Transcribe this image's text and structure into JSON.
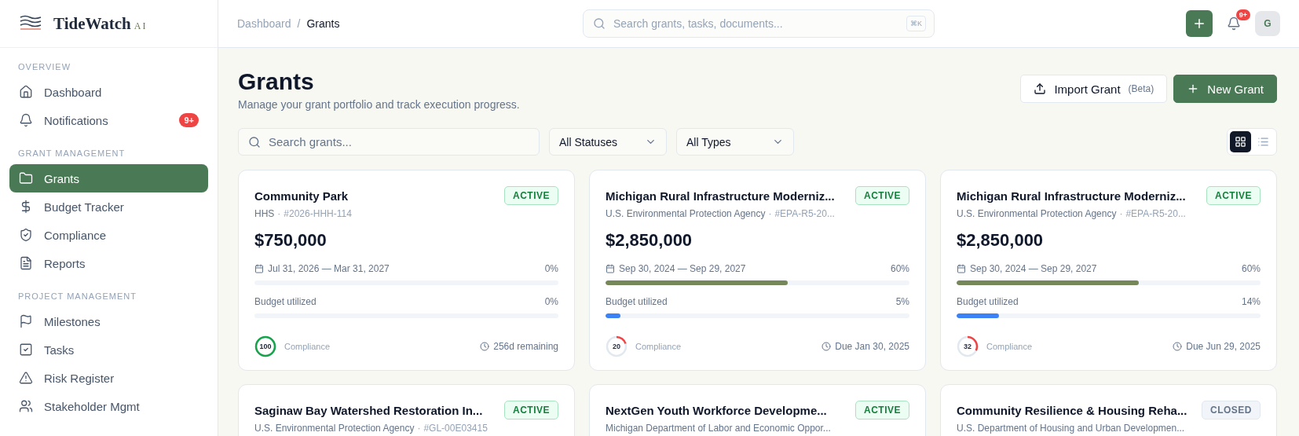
{
  "brand": {
    "name": "TideWatch",
    "suffix": "AI"
  },
  "sidebar": {
    "sections": [
      {
        "title": "OVERVIEW",
        "items": [
          {
            "label": "Dashboard",
            "selected": false
          },
          {
            "label": "Notifications",
            "selected": false,
            "badge": "9+"
          }
        ]
      },
      {
        "title": "GRANT MANAGEMENT",
        "items": [
          {
            "label": "Grants",
            "selected": true
          },
          {
            "label": "Budget Tracker",
            "selected": false
          },
          {
            "label": "Compliance",
            "selected": false
          },
          {
            "label": "Reports",
            "selected": false
          }
        ]
      },
      {
        "title": "PROJECT MANAGEMENT",
        "items": [
          {
            "label": "Milestones",
            "selected": false
          },
          {
            "label": "Tasks",
            "selected": false
          },
          {
            "label": "Risk Register",
            "selected": false
          },
          {
            "label": "Stakeholder Mgmt",
            "selected": false
          }
        ]
      }
    ]
  },
  "header": {
    "breadcrumbs": [
      "Dashboard",
      "Grants"
    ],
    "breadcrumb_separator": "/",
    "search": {
      "placeholder": "Search grants, tasks, documents...",
      "shortcut": "⌘K"
    },
    "notification_badge": "9+",
    "avatar": "G"
  },
  "page": {
    "title": "Grants",
    "subtitle": "Manage your grant portfolio and track execution progress.",
    "import_button": {
      "label": "Import Grant",
      "note": "(Beta)"
    },
    "new_button": "New Grant"
  },
  "filters": {
    "search_placeholder": "Search grants...",
    "status": "All Statuses",
    "type": "All Types",
    "views": [
      {
        "kind": "grid",
        "selected": true
      },
      {
        "kind": "list",
        "selected": false
      }
    ]
  },
  "grants": [
    {
      "title": "Community Park",
      "status": "ACTIVE",
      "agency": "HHS",
      "separator": "·",
      "number": "#2026-HHH-114",
      "amount": "$750,000",
      "dates": "Jul 31, 2026 — Mar 31, 2027",
      "timeline_percent": "0%",
      "timeline": {
        "level": 0
      },
      "budget_label": "Budget utilized",
      "budget_percent": "0%",
      "budget": {
        "level": 0
      },
      "compliance": {
        "score": "100",
        "level": 1
      },
      "compliance_label": "Compliance",
      "footer": "256d remaining"
    },
    {
      "title": "Michigan Rural Infrastructure Moderniz...",
      "status": "ACTIVE",
      "agency": "U.S. Environmental Protection Agency",
      "separator": "·",
      "number": "#EPA-R5-20...",
      "amount": "$2,850,000",
      "dates": "Sep 30, 2024 — Sep 29, 2027",
      "timeline_percent": "60%",
      "timeline": {
        "level": 0.6
      },
      "budget_label": "Budget utilized",
      "budget_percent": "5%",
      "budget": {
        "level": 0.05
      },
      "compliance": {
        "score": "20",
        "level": 0.2
      },
      "compliance_label": "Compliance",
      "footer": "Due Jan 30, 2025"
    },
    {
      "title": "Michigan Rural Infrastructure Moderniz...",
      "status": "ACTIVE",
      "agency": "U.S. Environmental Protection Agency",
      "separator": "·",
      "number": "#EPA-R5-20...",
      "amount": "$2,850,000",
      "dates": "Sep 30, 2024 — Sep 29, 2027",
      "timeline_percent": "60%",
      "timeline": {
        "level": 0.6
      },
      "budget_label": "Budget utilized",
      "budget_percent": "14%",
      "budget": {
        "level": 0.14
      },
      "compliance": {
        "score": "32",
        "level": 0.32
      },
      "compliance_label": "Compliance",
      "footer": "Due Jun 29, 2025"
    },
    {
      "title": "Saginaw Bay Watershed Restoration In...",
      "status": "ACTIVE",
      "agency": "U.S. Environmental Protection Agency",
      "separator": "·",
      "number": "#GL-00E03415"
    },
    {
      "title": "NextGen Youth Workforce Developme...",
      "status": "ACTIVE",
      "agency": "Michigan Department of Labor and Economic Oppor..."
    },
    {
      "title": "Community Resilience & Housing Reha...",
      "status": "CLOSED",
      "agency": "U.S. Department of Housing and Urban Developmen..."
    }
  ]
}
